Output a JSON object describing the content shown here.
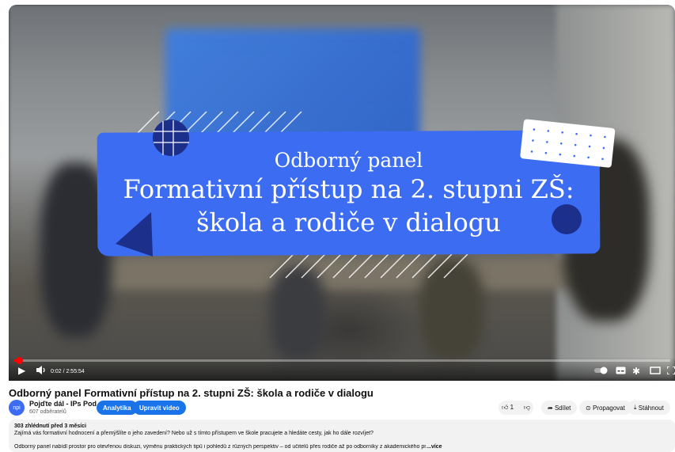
{
  "player": {
    "overlay_line1": "Odborný panel",
    "overlay_line2": "Formativní přístup na 2. stupni ZŠ:",
    "overlay_line3": "škola a rodiče v dialogu",
    "time": "0:02 / 2:55:54",
    "progress_fraction": 0.0002
  },
  "video": {
    "title": "Odborný panel Formativní přístup na 2. stupni ZŠ: škola a rodiče v dialogu"
  },
  "channel": {
    "avatar_text": "npi",
    "name": "Pojďte dál - IPs Pod...",
    "subscribers": "607 odběratelů"
  },
  "actions": {
    "analytics": "Analytika",
    "edit": "Upravit video",
    "likes": "1",
    "share": "Sdílet",
    "promote": "Propagovat",
    "download": "Stáhnout"
  },
  "description": {
    "meta": "303 zhlédnutí  před 3 měsíci",
    "line1": "Zajímá vás formativní hodnocení a přemýšlíte o jeho zavedení? Nebo už s tímto přístupem ve škole pracujete a hledáte cesty, jak ho dále rozvíjet?",
    "line2": "Odborný panel nabídl prostor pro otevřenou diskuzi, výměnu praktických tipů i pohledů z různých perspektiv – od učitelů přes rodiče až po odborníky z akademického prostředí.",
    "more": "...více"
  }
}
